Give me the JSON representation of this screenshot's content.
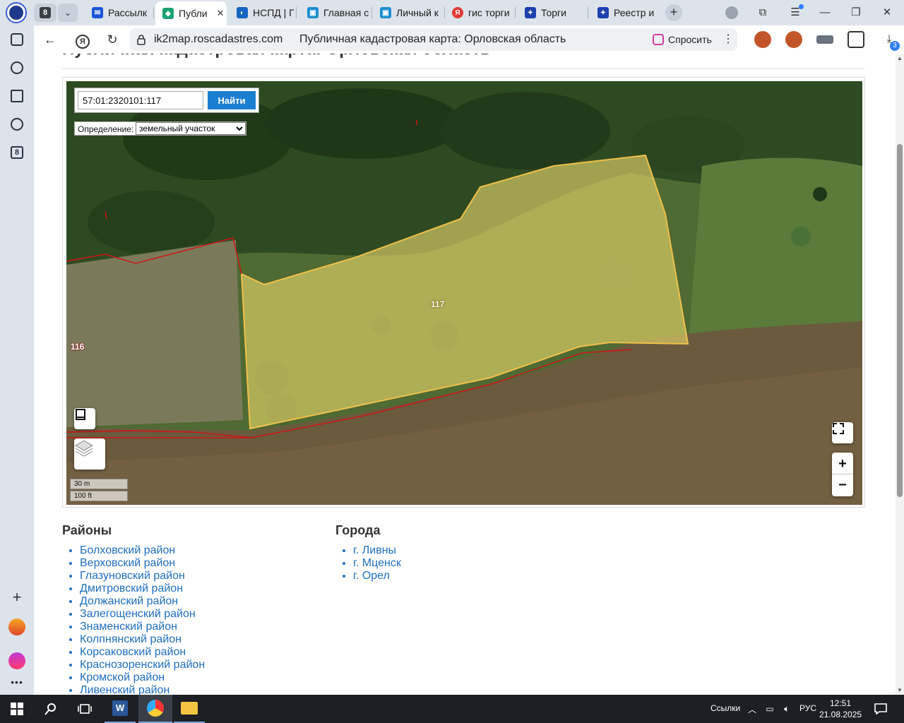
{
  "browser": {
    "tab_counter": "8",
    "tabs": [
      {
        "label": "Рассылк",
        "fav_color": "#1a56db"
      },
      {
        "label": "Публи",
        "fav_color": "#1aa36f",
        "active": true
      },
      {
        "label": "НСПД | Г",
        "fav_color": "#1565c0"
      },
      {
        "label": "Главная с",
        "fav_color": "#1a8fd1"
      },
      {
        "label": "Личный к",
        "fav_color": "#1a8fd1"
      },
      {
        "label": "гис торги",
        "fav_color": "#e53935"
      },
      {
        "label": "Торги",
        "fav_color": "#1e40af"
      },
      {
        "label": "Реестр и",
        "fav_color": "#1e40af"
      }
    ],
    "url": "ik2map.roscadastres.com",
    "page_title": "Публичная кадастровая карта: Орловская область",
    "ask_label": "Спросить",
    "downloads_badge": "3",
    "sidebar_badge": "8"
  },
  "page": {
    "heading": "Публичная кадастровая карта: Орловская область",
    "search": {
      "value": "57:01:2320101:117",
      "button": "Найти"
    },
    "definition": {
      "label": "Определение:",
      "selected": "земельный участок"
    },
    "map": {
      "parcel_label": "117",
      "neighbor_label": "116",
      "scale_metric": "30 m",
      "scale_imperial": "100 ft",
      "zoom_in": "+",
      "zoom_out": "−",
      "parcel_fill": "#e8d96a",
      "boundary_color": "#d01515"
    },
    "districts_title": "Районы",
    "districts": [
      "Болховский район",
      "Верховский район",
      "Глазуновский район",
      "Дмитровский район",
      "Должанский район",
      "Залегощенский район",
      "Знаменский район",
      "Колпнянский район",
      "Корсаковский район",
      "Краснозоренский район",
      "Кромской район",
      "Ливенский район"
    ],
    "cities_title": "Города",
    "cities": [
      "г. Ливны",
      "г. Мценск",
      "г. Орел"
    ]
  },
  "taskbar": {
    "links_label": "Ссылки",
    "lang": "РУС",
    "time": "12:51",
    "date": "21.08.2025"
  }
}
